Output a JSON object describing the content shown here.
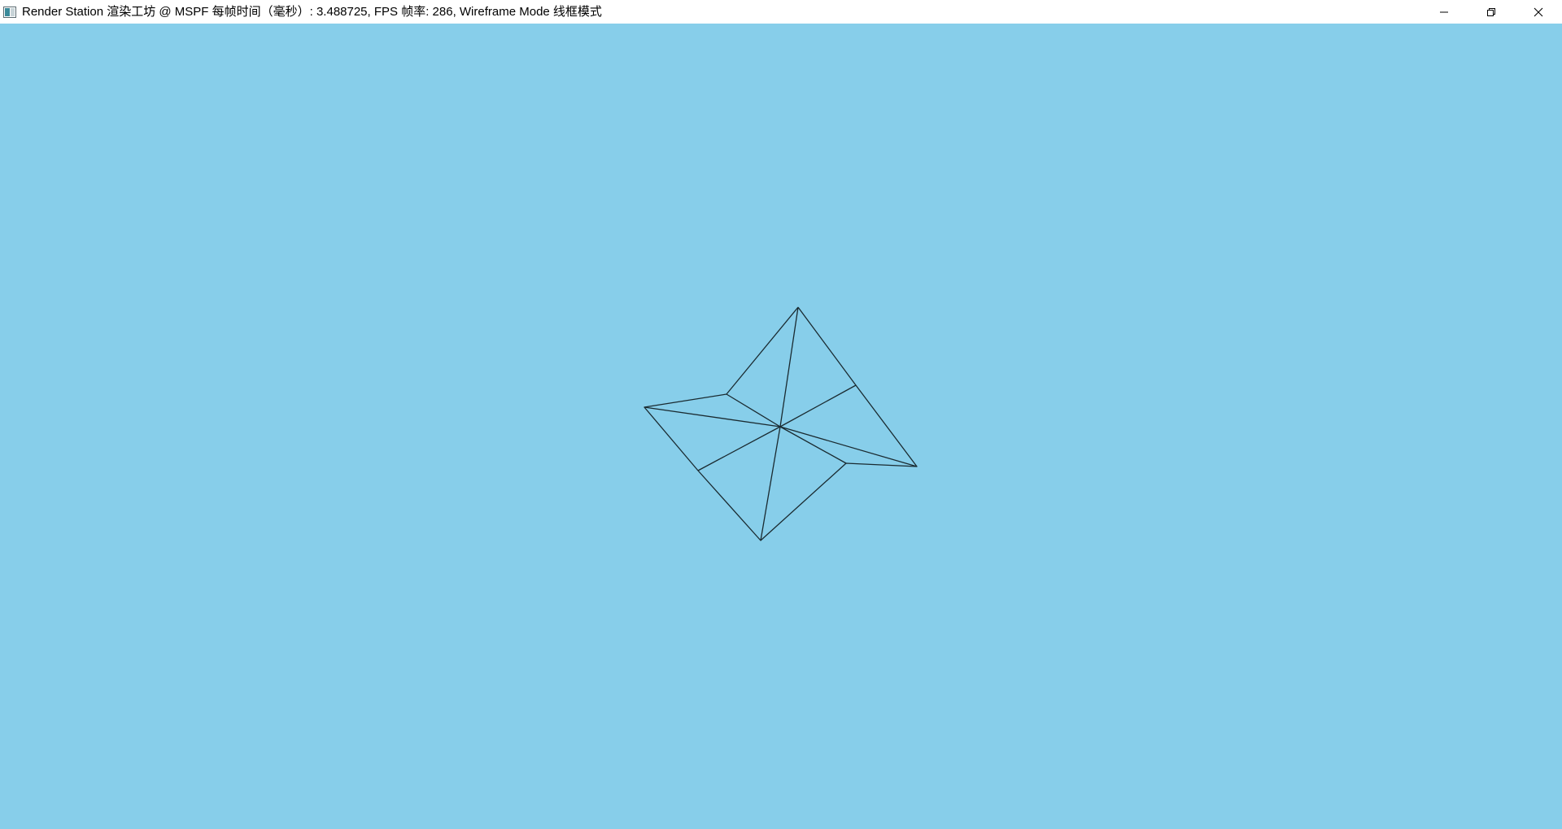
{
  "window": {
    "title": "Render Station 渲染工坊 @ MSPF 每帧时间（毫秒）: 3.488725, FPS 帧率: 286, Wireframe Mode 线框模式",
    "icons": {
      "app": "app-icon",
      "minimize": "minimize-icon",
      "restore": "restore-icon",
      "close": "close-icon"
    }
  },
  "viewport": {
    "background_color": "#87CEEA",
    "wireframe_color": "#1a2a30",
    "render_mode": "wireframe"
  }
}
